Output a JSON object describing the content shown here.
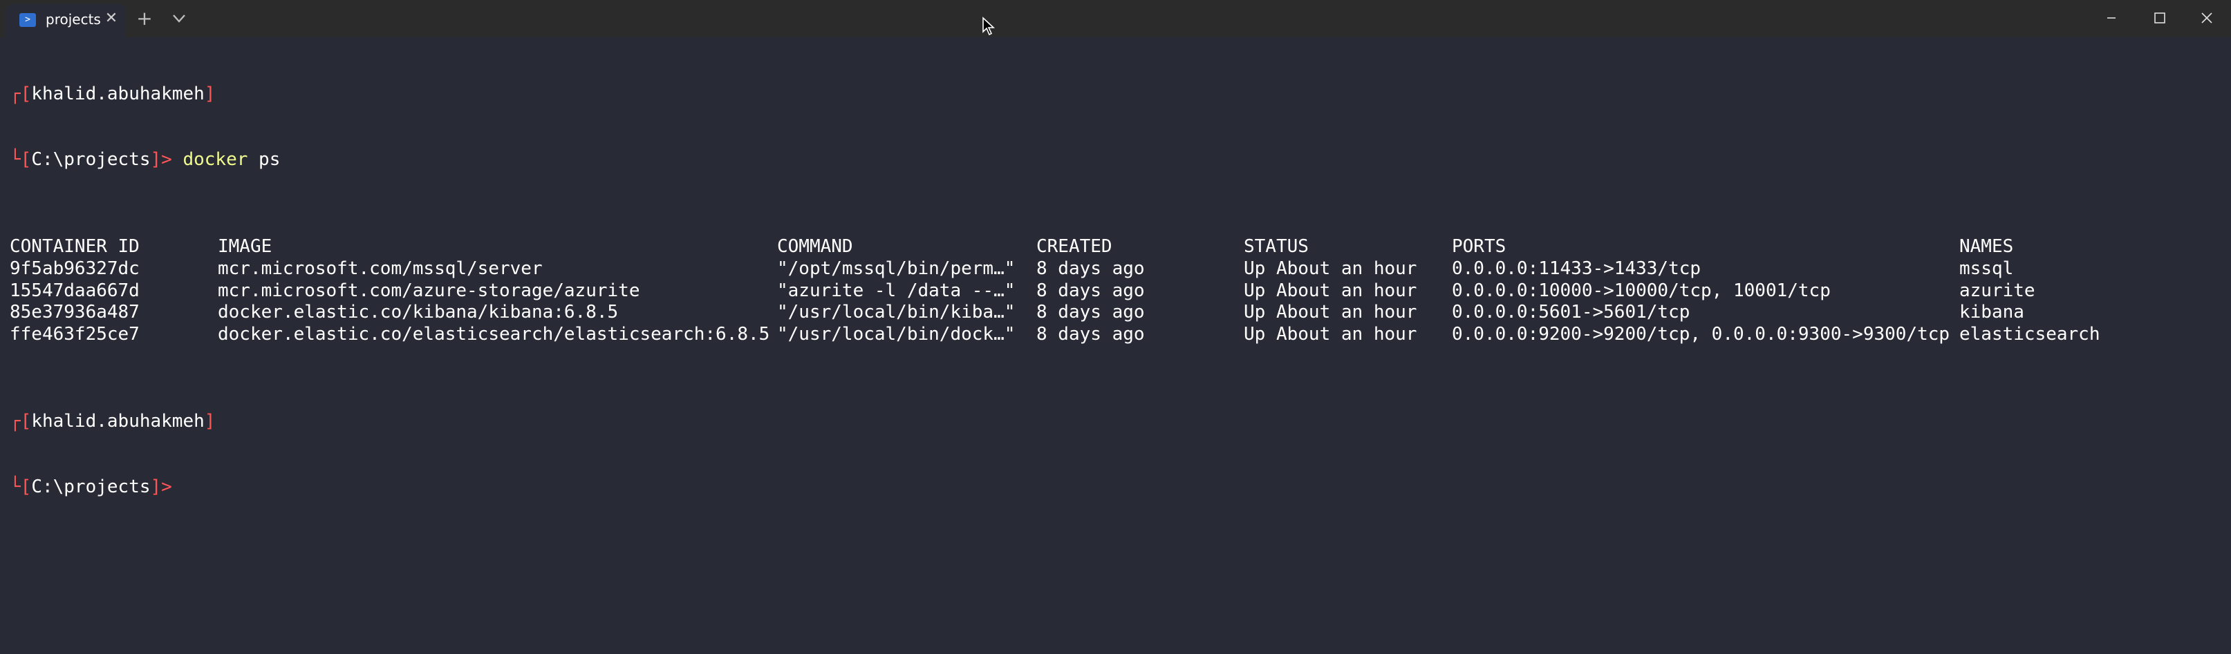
{
  "window": {
    "tab_title": "projects",
    "tab_icon": "powershell-icon",
    "tab_close": "✕",
    "new_tab": "+",
    "colors": {
      "background": "#282a36",
      "titlebar": "#2b2b2b",
      "prompt_red": "#ff5555",
      "command_yellow": "#f1fa8c",
      "text": "#ffffff"
    }
  },
  "terminal": {
    "prompt1": {
      "corner_top": "┌",
      "user_open": "[",
      "user": "khalid.abuhakmeh",
      "user_close": "]",
      "corner_bottom": "└",
      "path_open": "[",
      "path": "C:\\projects",
      "path_close": "]>",
      "command": "docker",
      "args": "ps"
    },
    "table": {
      "headers": [
        "CONTAINER ID",
        "IMAGE",
        "COMMAND",
        "CREATED",
        "STATUS",
        "PORTS",
        "NAMES"
      ],
      "rows": [
        [
          "9f5ab96327dc",
          "mcr.microsoft.com/mssql/server",
          "\"/opt/mssql/bin/perm…\"",
          "8 days ago",
          "Up About an hour",
          "0.0.0.0:11433->1433/tcp",
          "mssql"
        ],
        [
          "15547daa667d",
          "mcr.microsoft.com/azure-storage/azurite",
          "\"azurite -l /data --…\"",
          "8 days ago",
          "Up About an hour",
          "0.0.0.0:10000->10000/tcp, 10001/tcp",
          "azurite"
        ],
        [
          "85e37936a487",
          "docker.elastic.co/kibana/kibana:6.8.5",
          "\"/usr/local/bin/kiba…\"",
          "8 days ago",
          "Up About an hour",
          "0.0.0.0:5601->5601/tcp",
          "kibana"
        ],
        [
          "ffe463f25ce7",
          "docker.elastic.co/elasticsearch/elasticsearch:6.8.5",
          "\"/usr/local/bin/dock…\"",
          "8 days ago",
          "Up About an hour",
          "0.0.0.0:9200->9200/tcp, 0.0.0.0:9300->9300/tcp",
          "elasticsearch"
        ]
      ]
    },
    "prompt2": {
      "corner_top": "┌",
      "user_open": "[",
      "user": "khalid.abuhakmeh",
      "user_close": "]",
      "corner_bottom": "└",
      "path_open": "[",
      "path": "C:\\projects",
      "path_close": "]>"
    }
  }
}
